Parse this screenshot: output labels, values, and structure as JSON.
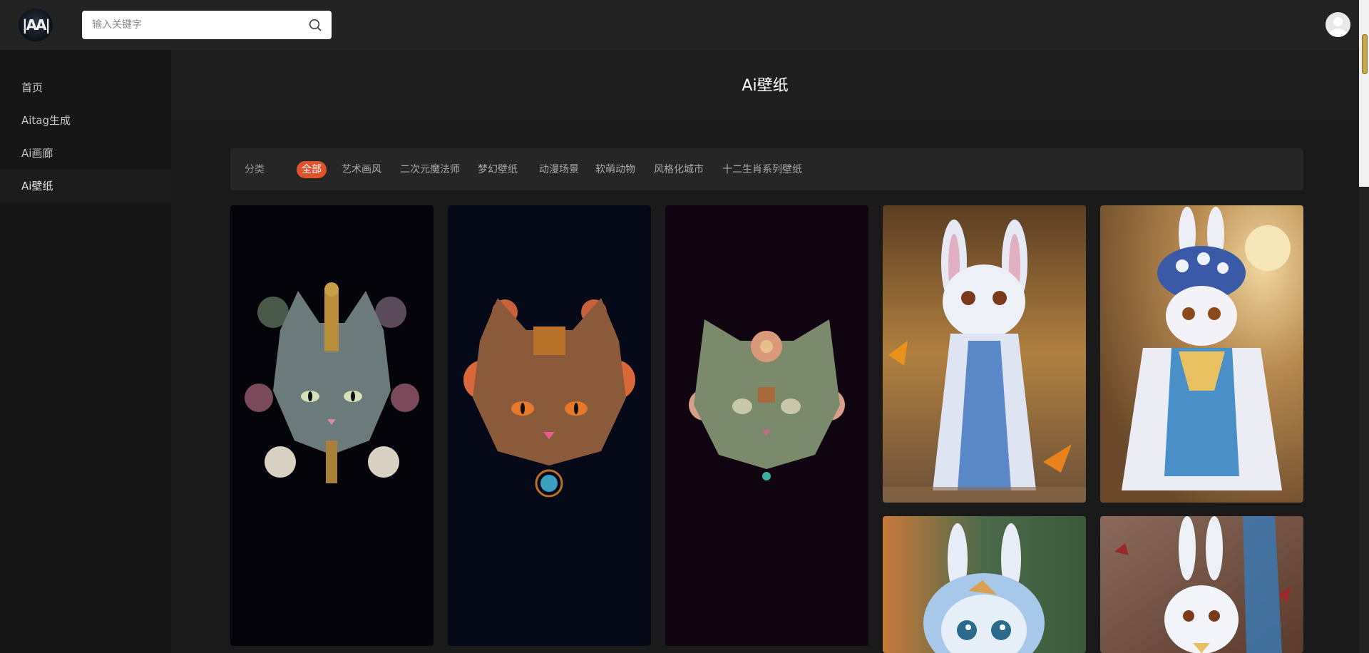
{
  "header": {
    "logo_text": "|AA|",
    "search": {
      "placeholder": "输入关键字",
      "value": ""
    }
  },
  "sidebar": {
    "items": [
      {
        "label": "首页"
      },
      {
        "label": "Aitag生成"
      },
      {
        "label": "Ai画廊"
      },
      {
        "label": "Ai壁纸",
        "active": true
      }
    ]
  },
  "page": {
    "title": "Ai壁纸"
  },
  "categories": {
    "label": "分类",
    "tabs": [
      {
        "label": "全部",
        "active": true
      },
      {
        "label": "艺术画风"
      },
      {
        "label": "二次元魔法师"
      },
      {
        "label": "梦幻壁纸"
      },
      {
        "label": "动漫场景"
      },
      {
        "label": "软萌动物"
      },
      {
        "label": "风格化城市"
      },
      {
        "label": "十二生肖系列壁纸"
      }
    ]
  },
  "gallery": [
    {
      "subject": "cat-steampunk",
      "bg": "#04040a"
    },
    {
      "subject": "cat-floral-orange",
      "bg": "#060a18"
    },
    {
      "subject": "cat-floral-purple",
      "bg": "#110512"
    },
    {
      "subject": "bunny-blue-robe",
      "bg": "#6a4a2a"
    },
    {
      "subject": "bunny-flower-hat",
      "bg": "#8a6a40"
    },
    {
      "subject": "bunny-blue-closeup",
      "bg": "#4a5a3a"
    },
    {
      "subject": "bunny-white-red-leaves",
      "bg": "#7a5a4a"
    }
  ],
  "colors": {
    "accent": "#e0522c",
    "topbar": "#232323",
    "sidebar": "#161616"
  }
}
